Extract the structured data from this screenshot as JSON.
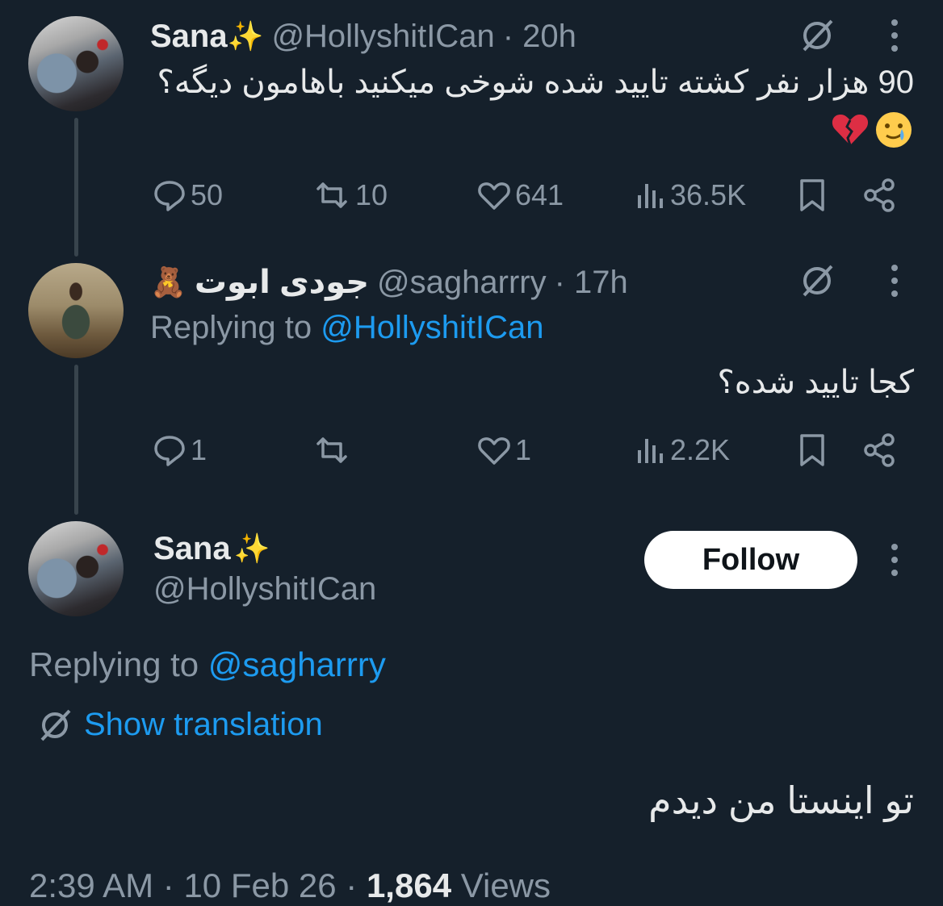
{
  "colors": {
    "background": "#15202b",
    "text": "#e7e9ea",
    "muted": "#8b98a5",
    "link": "#1d9bf0",
    "thread_line": "#38444d"
  },
  "tweet1": {
    "name": "Sana",
    "name_emoji": "✨",
    "handle": "@HollyshitICan",
    "time": "· 20h",
    "text": "90 هزار نفر کشته تایید شده شوخی میکنید باهامون دیگه؟",
    "emojis": [
      "broken-heart-icon",
      "crying-smile-face-icon"
    ],
    "replies": "50",
    "retweets": "10",
    "likes": "641",
    "views": "36.5K"
  },
  "tweet2": {
    "name": "جودی ابوت",
    "name_emoji": "🧸",
    "handle": "@sagharrry",
    "time": "· 17h",
    "replying_prefix": "Replying to",
    "replying_to": "@HollyshitICan",
    "text": "کجا تایید شده؟",
    "replies": "1",
    "likes": "1",
    "views": "2.2K"
  },
  "main_tweet": {
    "name": "Sana",
    "name_emoji": "✨",
    "handle": "@HollyshitICan",
    "follow_label": "Follow",
    "replying_prefix": "Replying to",
    "replying_to": "@sagharrry",
    "translate_label": "Show translation",
    "text": "تو اینستا من دیدم",
    "time": "2:39 AM",
    "date": "10 Feb 26",
    "views_count": "1,864",
    "views_label": "Views"
  }
}
